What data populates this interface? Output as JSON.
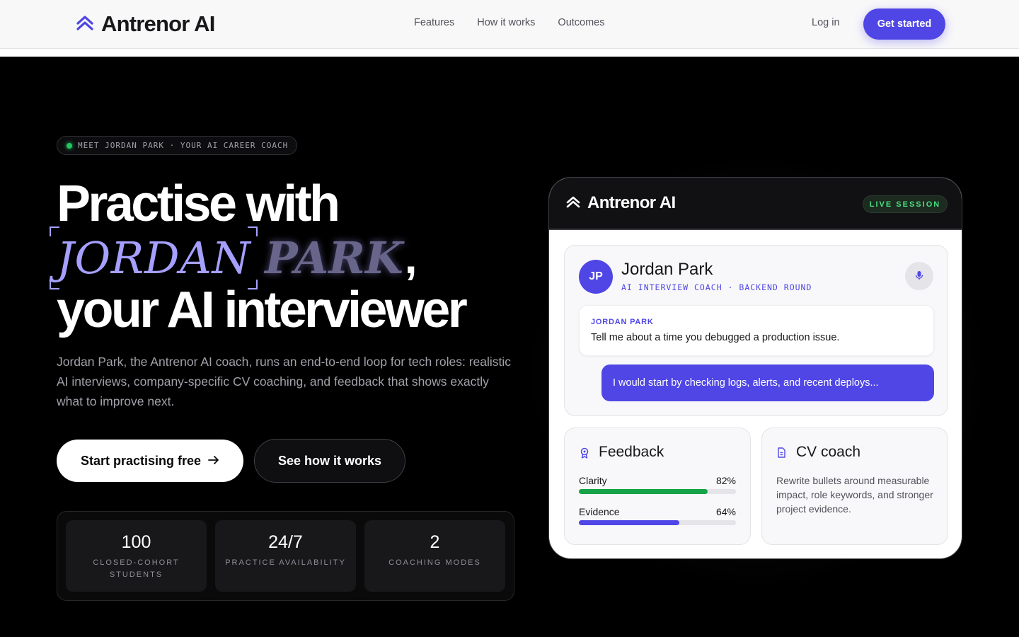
{
  "nav": {
    "brand": "Antrenor AI",
    "links": [
      "Features",
      "How it works",
      "Outcomes"
    ],
    "login": "Log in",
    "cta": "Get started"
  },
  "hero": {
    "eyebrow": "MEET JORDAN PARK · YOUR AI CAREER COACH",
    "headline_1": "Practise with",
    "headline_name_first": "JORDAN",
    "headline_name_last": "PARK",
    "headline_comma": ",",
    "headline_3": "your AI interviewer",
    "lede": "Jordan Park, the Antrenor AI coach, runs an end-to-end loop for tech roles: realistic AI interviews, company-specific CV coaching, and feedback that shows exactly what to improve next.",
    "primary_cta": "Start practising free",
    "primary_cta_icon": "arrow-right-icon",
    "secondary_cta": "See how it works",
    "stats": [
      {
        "value": "100",
        "label": "CLOSED-COHORT STUDENTS"
      },
      {
        "value": "24/7",
        "label": "PRACTICE AVAILABILITY"
      },
      {
        "value": "2",
        "label": "COACHING MODES"
      }
    ]
  },
  "card": {
    "brand": "Antrenor AI",
    "live_badge": "LIVE SESSION",
    "coach": {
      "initials": "JP",
      "name": "Jordan Park",
      "role": "AI INTERVIEW COACH · BACKEND ROUND"
    },
    "question": {
      "speaker": "JORDAN PARK",
      "text": "Tell me about a time you debugged a production issue."
    },
    "answer": "I would start by checking logs, alerts, and recent deploys...",
    "feedback": {
      "title": "Feedback",
      "metrics": [
        {
          "label": "Clarity",
          "value": "82%",
          "fraction": 0.82,
          "color": "#16a34a"
        },
        {
          "label": "Evidence",
          "value": "64%",
          "fraction": 0.64,
          "color": "#4f46e5"
        }
      ]
    },
    "cv": {
      "title": "CV coach",
      "text": "Rewrite bullets around measurable impact, role keywords, and stronger project evidence."
    }
  },
  "colors": {
    "accent": "#4f46e5",
    "accent_light": "#a5a0ff",
    "live_green": "#4ade80",
    "background": "#000000"
  }
}
